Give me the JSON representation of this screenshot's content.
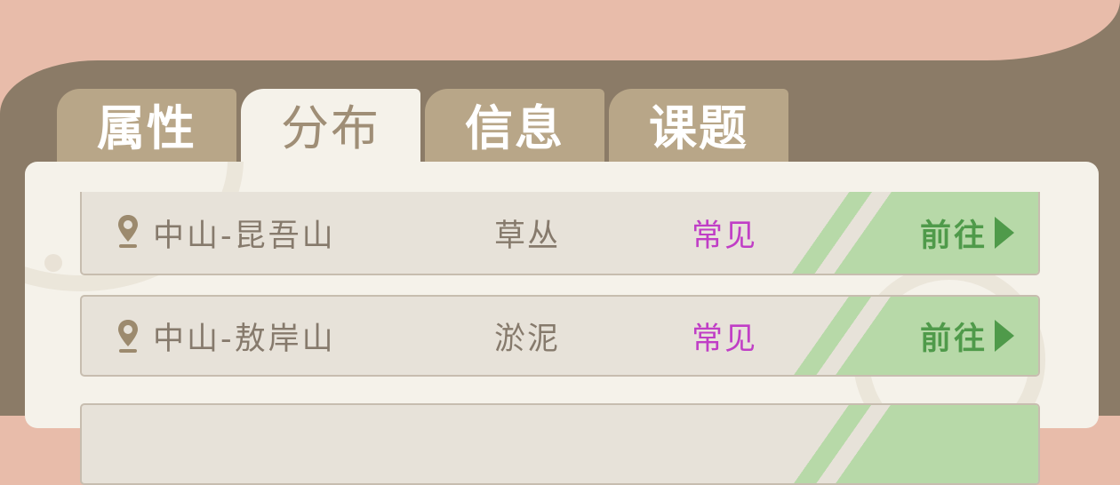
{
  "tabs": [
    {
      "label": "属性",
      "active": false
    },
    {
      "label": "分布",
      "active": true
    },
    {
      "label": "信息",
      "active": false
    },
    {
      "label": "课题",
      "active": false
    }
  ],
  "rows": [
    {
      "location": "中山-昆吾山",
      "terrain": "草丛",
      "rarity": "常见",
      "action": "前往"
    },
    {
      "location": "中山-敖岸山",
      "terrain": "淤泥",
      "rarity": "常见",
      "action": "前往"
    }
  ],
  "colors": {
    "rarity_common": "#c03ec6",
    "action_green": "#4f9a4a",
    "tab_inactive": "#b8a688",
    "tab_active_bg": "#f5f2ea",
    "header_pink": "#e8bcaa",
    "frame_brown": "#8b7b67"
  },
  "icons": {
    "location": "map-pin-icon",
    "go": "arrow-right-icon"
  }
}
